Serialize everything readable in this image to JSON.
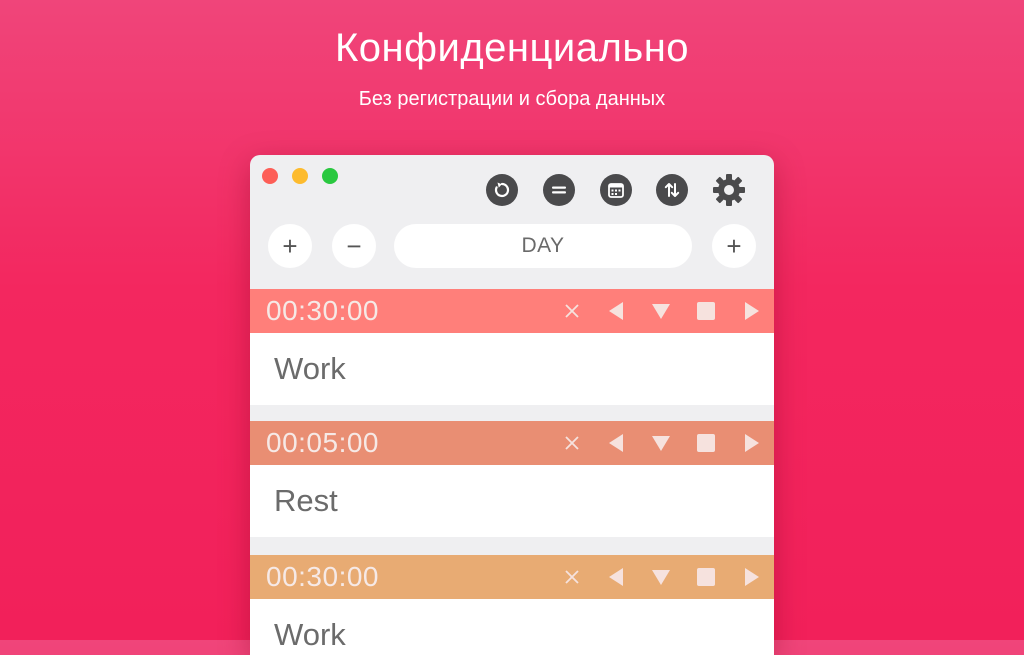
{
  "promo": {
    "title": "Конфиденциально",
    "subtitle": "Без регистрации и сбора данных"
  },
  "window": {
    "toolbar_icons": [
      "reset-icon",
      "equals-icon",
      "calendar-icon",
      "sort-arrows-icon",
      "gear-icon"
    ],
    "add_left_label": "+",
    "minus_label": "−",
    "period_value": "DAY",
    "add_right_label": "+"
  },
  "timers": [
    {
      "time": "00:30:00",
      "name": "Work",
      "color": "#ff7f7a"
    },
    {
      "time": "00:05:00",
      "name": "Rest",
      "color": "#e98e73"
    },
    {
      "time": "00:30:00",
      "name": "Work",
      "color": "#e8ab73"
    }
  ],
  "colors": {
    "background": "#f2285f",
    "icon_dark": "#4a4a4c"
  }
}
